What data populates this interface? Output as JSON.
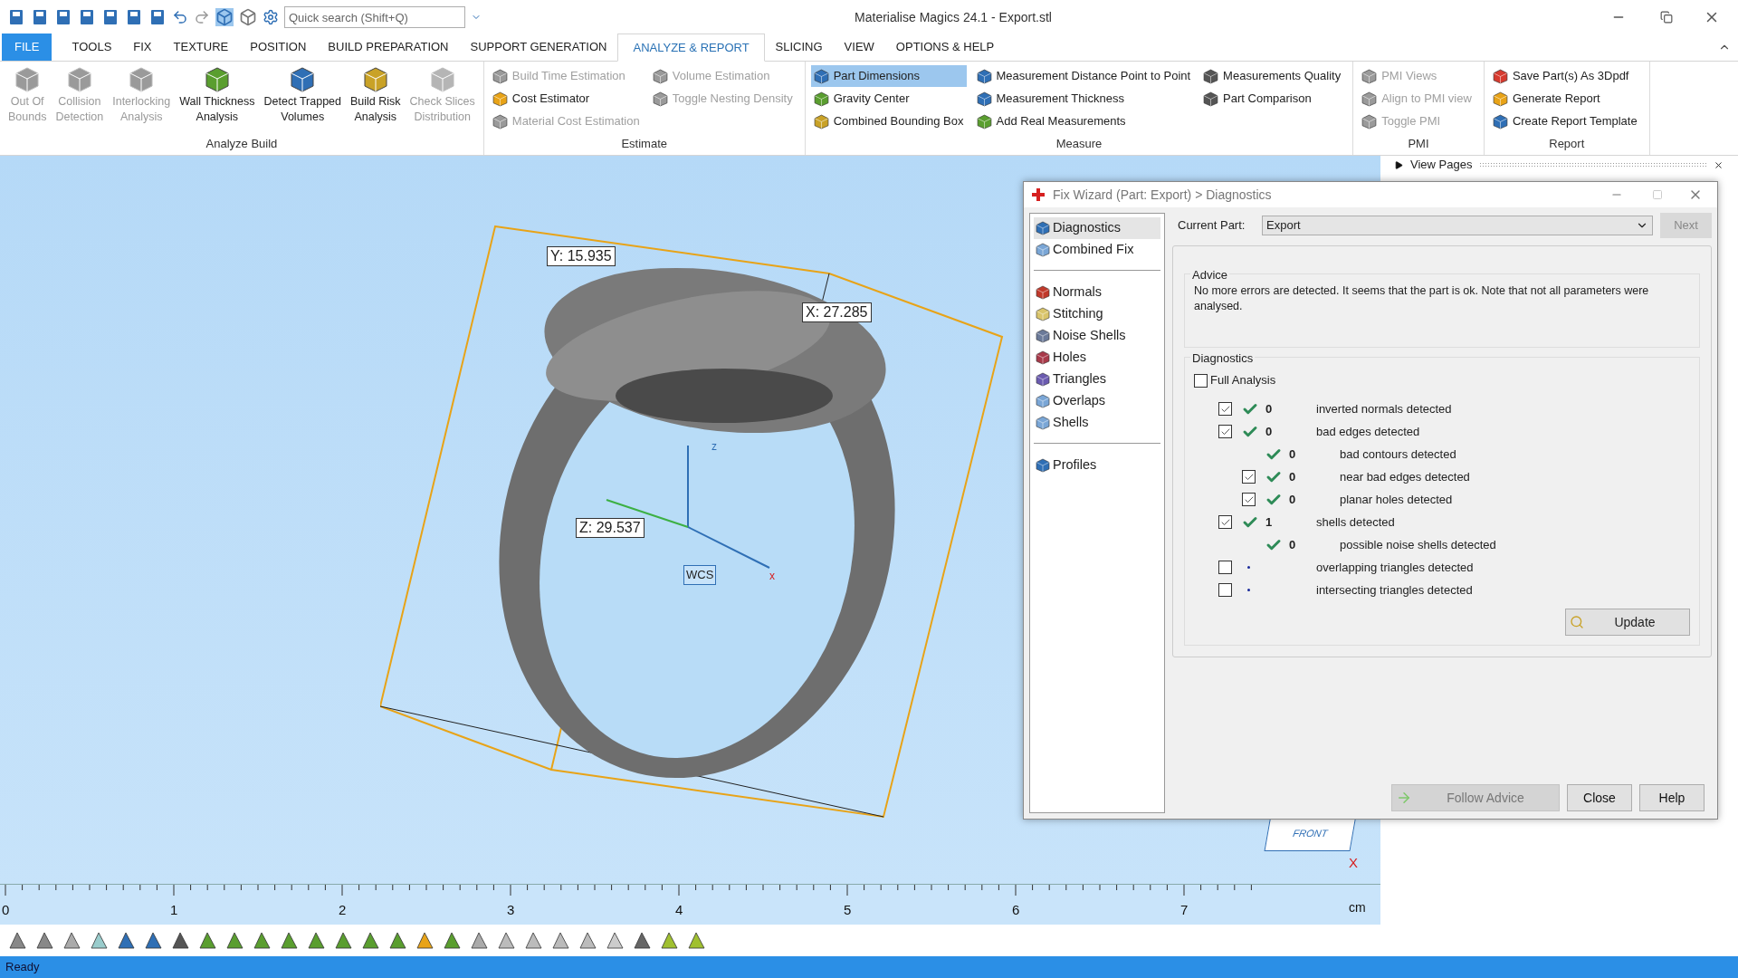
{
  "window": {
    "title": "Materialise Magics 24.1 - Export.stl"
  },
  "quick_search": {
    "placeholder": "Quick search (Shift+Q)"
  },
  "tabs": [
    {
      "label": "FILE",
      "kind": "file",
      "selected": false
    },
    {
      "label": "TOOLS",
      "kind": "tab",
      "selected": false
    },
    {
      "label": "FIX",
      "kind": "tab",
      "selected": false
    },
    {
      "label": "TEXTURE",
      "kind": "tab",
      "selected": false
    },
    {
      "label": "POSITION",
      "kind": "tab",
      "selected": false
    },
    {
      "label": "BUILD PREPARATION",
      "kind": "tab",
      "selected": false
    },
    {
      "label": "SUPPORT GENERATION",
      "kind": "tab",
      "selected": false
    },
    {
      "label": "ANALYZE & REPORT",
      "kind": "tab",
      "selected": true
    },
    {
      "label": "SLICING",
      "kind": "tab",
      "selected": false
    },
    {
      "label": "VIEW",
      "kind": "tab",
      "selected": false
    },
    {
      "label": "OPTIONS & HELP",
      "kind": "tab",
      "selected": false
    }
  ],
  "ribbon_groups": [
    {
      "title": "Analyze Build",
      "kind": "large",
      "items": [
        {
          "label": "Out Of\nBounds",
          "disabled": true,
          "color": "#9a9a9a"
        },
        {
          "label": "Collision\nDetection",
          "disabled": true,
          "color": "#9a9a9a"
        },
        {
          "label": "Interlocking\nAnalysis",
          "disabled": true,
          "color": "#9a9a9a"
        },
        {
          "label": "Wall Thickness\nAnalysis",
          "disabled": false,
          "color": "#5a9e2f"
        },
        {
          "label": "Detect Trapped\nVolumes",
          "disabled": false,
          "color": "#2f6fb5"
        },
        {
          "label": "Build Risk\nAnalysis",
          "disabled": false,
          "color": "#c9a227"
        },
        {
          "label": "Check Slices\nDistribution",
          "disabled": true,
          "color": "#b5b5b5"
        }
      ]
    },
    {
      "title": "Estimate",
      "kind": "small",
      "columns": [
        [
          {
            "label": "Build Time Estimation",
            "disabled": true,
            "selected": false,
            "color": "#9a9a9a"
          },
          {
            "label": "Cost Estimator",
            "disabled": false,
            "selected": false,
            "color": "#e8a317"
          },
          {
            "label": "Material Cost Estimation",
            "disabled": true,
            "selected": false,
            "color": "#9a9a9a"
          }
        ],
        [
          {
            "label": "Volume Estimation",
            "disabled": true,
            "selected": false,
            "color": "#9a9a9a"
          },
          {
            "label": "Toggle Nesting Density",
            "disabled": true,
            "selected": false,
            "color": "#9a9a9a"
          }
        ]
      ]
    },
    {
      "title": "Measure",
      "kind": "small",
      "columns": [
        [
          {
            "label": "Part Dimensions",
            "disabled": false,
            "selected": true,
            "color": "#2f6fb5"
          },
          {
            "label": "Gravity Center",
            "disabled": false,
            "selected": false,
            "color": "#5a9e2f"
          },
          {
            "label": "Combined Bounding Box",
            "disabled": false,
            "selected": false,
            "color": "#c9a227"
          }
        ],
        [
          {
            "label": "Measurement Distance Point to Point",
            "disabled": false,
            "selected": false,
            "color": "#2f6fb5"
          },
          {
            "label": "Measurement Thickness",
            "disabled": false,
            "selected": false,
            "color": "#2f6fb5"
          },
          {
            "label": "Add Real Measurements",
            "disabled": false,
            "selected": false,
            "color": "#5a9e2f"
          }
        ],
        [
          {
            "label": "Measurements Quality",
            "disabled": false,
            "selected": false,
            "color": "#555555"
          },
          {
            "label": "Part Comparison",
            "disabled": false,
            "selected": false,
            "color": "#555555"
          }
        ]
      ]
    },
    {
      "title": "PMI",
      "kind": "small",
      "columns": [
        [
          {
            "label": "PMI Views",
            "disabled": true,
            "selected": false,
            "color": "#9a9a9a"
          },
          {
            "label": "Align to PMI view",
            "disabled": true,
            "selected": false,
            "color": "#9a9a9a"
          },
          {
            "label": "Toggle PMI",
            "disabled": true,
            "selected": false,
            "color": "#9a9a9a"
          }
        ]
      ]
    },
    {
      "title": "Report",
      "kind": "small",
      "columns": [
        [
          {
            "label": "Save Part(s) As 3Dpdf",
            "disabled": false,
            "selected": false,
            "color": "#d63b2f"
          },
          {
            "label": "Generate Report",
            "disabled": false,
            "selected": false,
            "color": "#e8a317"
          },
          {
            "label": "Create Report Template",
            "disabled": false,
            "selected": false,
            "color": "#2f6fb5"
          }
        ]
      ]
    }
  ],
  "viewport": {
    "measurements": [
      "Y: 15.935",
      "X: 27.285",
      "Z: 29.537"
    ],
    "wcs": {
      "label": "WCS",
      "axis_labels": [
        "z",
        "x"
      ]
    },
    "view_cube": {
      "face": "FRONT",
      "axis": "X"
    }
  },
  "ruler": {
    "ticks": [
      "0",
      "1",
      "2",
      "3",
      "4",
      "5",
      "6",
      "7"
    ],
    "unit": "cm"
  },
  "side_panel": {
    "view_pages": "View Pages"
  },
  "fix_wizard": {
    "title": "Fix Wizard (Part: Export) > Diagnostics",
    "nav_groups": [
      [
        {
          "label": "Diagnostics",
          "selected": true,
          "color": "#2f6fb5"
        },
        {
          "label": "Combined Fix",
          "selected": false,
          "color": "#7aa6d6"
        }
      ],
      [
        {
          "label": "Normals",
          "selected": false,
          "color": "#c0392b"
        },
        {
          "label": "Stitching",
          "selected": false,
          "color": "#d9c46a"
        },
        {
          "label": "Noise Shells",
          "selected": false,
          "color": "#6b7a99"
        },
        {
          "label": "Holes",
          "selected": false,
          "color": "#a83a4a"
        },
        {
          "label": "Triangles",
          "selected": false,
          "color": "#6b5bb0"
        },
        {
          "label": "Overlaps",
          "selected": false,
          "color": "#7aa6d6"
        },
        {
          "label": "Shells",
          "selected": false,
          "color": "#7aa6d6"
        }
      ],
      [
        {
          "label": "Profiles",
          "selected": false,
          "color": "#2f6fb5"
        }
      ]
    ],
    "current_part": {
      "label": "Current Part:",
      "value": "Export"
    },
    "next_button": {
      "label": "Next",
      "disabled": true
    },
    "advice": {
      "title": "Advice",
      "text": "No more errors are detected. It seems that the part is ok. Note that not all parameters were analysed."
    },
    "diagnostics": {
      "title": "Diagnostics",
      "full_analysis": {
        "label": "Full Analysis",
        "checked": false
      },
      "rows": [
        {
          "kind": "checkbox",
          "checked": true,
          "passed": true,
          "count": "0",
          "label": "inverted normals detected"
        },
        {
          "kind": "checkbox",
          "checked": true,
          "passed": true,
          "count": "0",
          "label": "bad edges detected",
          "children": [
            {
              "kind": "plain",
              "passed": true,
              "count": "0",
              "label": "bad contours detected"
            },
            {
              "kind": "checkbox",
              "checked": true,
              "passed": true,
              "count": "0",
              "label": "near bad edges detected"
            },
            {
              "kind": "checkbox",
              "checked": true,
              "passed": true,
              "count": "0",
              "label": "planar holes detected"
            }
          ]
        },
        {
          "kind": "checkbox",
          "checked": true,
          "passed": true,
          "count": "1",
          "label": "shells detected",
          "children": [
            {
              "kind": "plain",
              "passed": true,
              "count": "0",
              "label": "possible noise shells detected"
            }
          ]
        },
        {
          "kind": "checkbox",
          "checked": false,
          "passed": false,
          "label": "overlapping triangles detected"
        },
        {
          "kind": "checkbox",
          "checked": false,
          "passed": false,
          "label": "intersecting triangles detected"
        }
      ],
      "update_button": "Update"
    },
    "footer_buttons": [
      {
        "label": "Follow Advice",
        "disabled": true
      },
      {
        "label": "Close",
        "disabled": false
      },
      {
        "label": "Help",
        "disabled": false
      }
    ]
  },
  "status_bar": {
    "text": "Ready"
  }
}
